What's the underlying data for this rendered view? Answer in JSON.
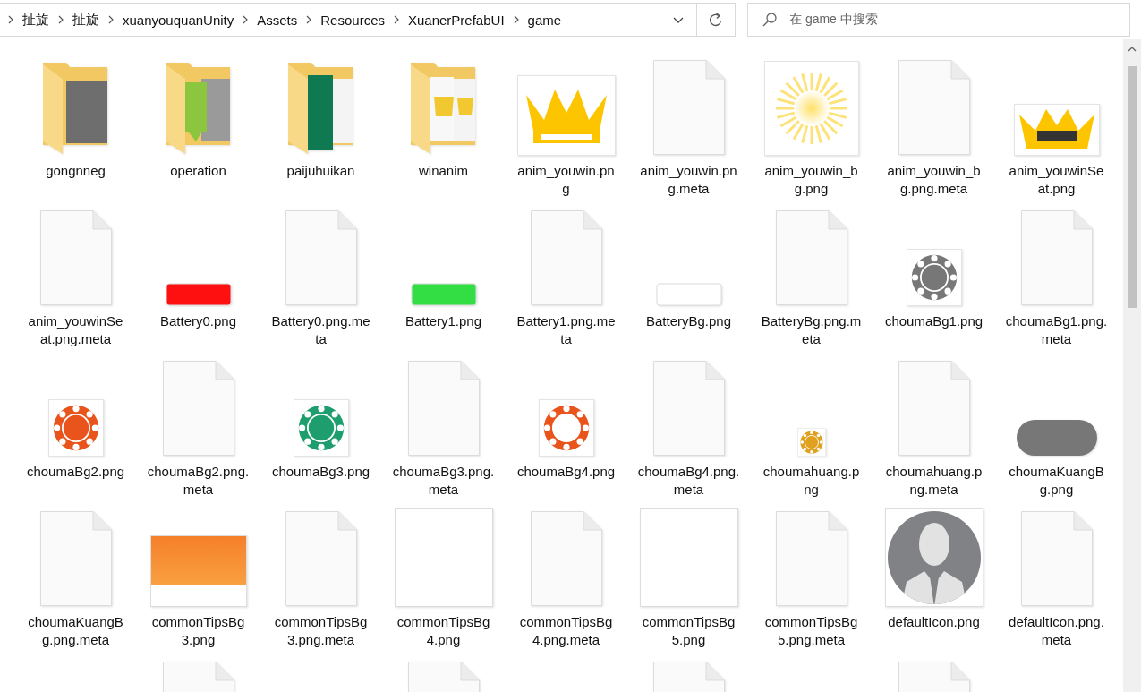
{
  "address_bar": {
    "crumbs": [
      "扯旋",
      "扯旋",
      "xuanyouquanUnity",
      "Assets",
      "Resources",
      "XuanerPrefabUI",
      "game"
    ]
  },
  "search": {
    "placeholder": "在 game 中搜索"
  },
  "items": [
    {
      "label": "gongnneg",
      "kind": "darkfolder"
    },
    {
      "label": "operation",
      "kind": "tipsfolder"
    },
    {
      "label": "paijuhuikan",
      "kind": "cardfolder"
    },
    {
      "label": "winanim",
      "kind": "winfolder"
    },
    {
      "label": "anim_youwin.png",
      "kind": "crown"
    },
    {
      "label": "anim_youwin.png.meta",
      "kind": "file"
    },
    {
      "label": "anim_youwin_bg.png",
      "kind": "sunburst"
    },
    {
      "label": "anim_youwin_bg.png.meta",
      "kind": "file"
    },
    {
      "label": "anim_youwinSeat.png",
      "kind": "smallcrown"
    },
    {
      "label": "anim_youwinSeat.png.meta",
      "kind": "file"
    },
    {
      "label": "Battery0.png",
      "kind": "bar",
      "color": "#ff1010"
    },
    {
      "label": "Battery0.png.meta",
      "kind": "file"
    },
    {
      "label": "Battery1.png",
      "kind": "bar",
      "color": "#33dd44"
    },
    {
      "label": "Battery1.png.meta",
      "kind": "file"
    },
    {
      "label": "BatteryBg.png",
      "kind": "bar",
      "color": "#ffffff"
    },
    {
      "label": "BatteryBg.png.meta",
      "kind": "file"
    },
    {
      "label": "choumaBg1.png",
      "kind": "chip",
      "color": "#777777"
    },
    {
      "label": "choumaBg1.png.meta",
      "kind": "file"
    },
    {
      "label": "choumaBg2.png",
      "kind": "chip",
      "color": "#e8541c"
    },
    {
      "label": "choumaBg2.png.meta",
      "kind": "file"
    },
    {
      "label": "choumaBg3.png",
      "kind": "chip",
      "color": "#1e9e6e"
    },
    {
      "label": "choumaBg3.png.meta",
      "kind": "file"
    },
    {
      "label": "choumaBg4.png",
      "kind": "ring",
      "color": "#e8541c"
    },
    {
      "label": "choumaBg4.png.meta",
      "kind": "file"
    },
    {
      "label": "choumahuang.png",
      "kind": "smallchip",
      "color": "#e0a020"
    },
    {
      "label": "choumahuang.png.meta",
      "kind": "file"
    },
    {
      "label": "choumaKuangBg.png",
      "kind": "pill",
      "color": "#777777"
    },
    {
      "label": "choumaKuangBg.png.meta",
      "kind": "file"
    },
    {
      "label": "commonTipsBg3.png",
      "kind": "banner"
    },
    {
      "label": "commonTipsBg3.png.meta",
      "kind": "file"
    },
    {
      "label": "commonTipsBg4.png",
      "kind": "blank"
    },
    {
      "label": "commonTipsBg4.png.meta",
      "kind": "file"
    },
    {
      "label": "commonTipsBg5.png",
      "kind": "blank"
    },
    {
      "label": "commonTipsBg5.png.meta",
      "kind": "file"
    },
    {
      "label": "defaultIcon.png",
      "kind": "avatar"
    },
    {
      "label": "defaultIcon.png.meta",
      "kind": "file"
    }
  ],
  "partial_items": [
    {
      "kind": "file"
    },
    {
      "kind": "file"
    },
    {
      "kind": "file"
    },
    {
      "kind": "file"
    }
  ]
}
